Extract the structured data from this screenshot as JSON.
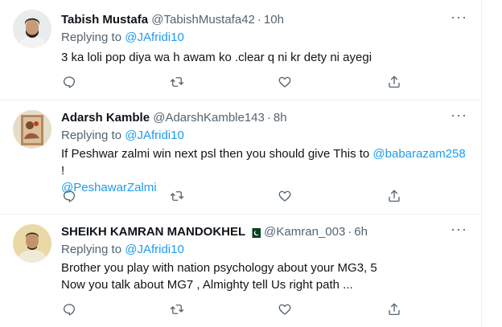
{
  "tweets": [
    {
      "name": "Tabish Mustafa",
      "handle": "@TabishMustafa42",
      "time": "10h",
      "replying_prefix": "Replying to ",
      "replying_to": "@JAfridi10",
      "text": "3 ka loli pop diya wa h awam ko .clear q ni kr dety ni ayegi"
    },
    {
      "name": "Adarsh Kamble",
      "handle": "@AdarshKamble143",
      "time": "8h",
      "replying_prefix": "Replying to ",
      "replying_to": "@JAfridi10",
      "text_pre": "If Peshwar zalmi win next psl then you should give This to ",
      "mention1": "@babarazam258",
      "text_post": " !",
      "mention2": "@PeshawarZalmi"
    },
    {
      "name": "SHEIKH KAMRAN MANDOKHEL",
      "handle": "@Kamran_003",
      "time": "6h",
      "replying_prefix": "Replying to ",
      "replying_to": "@JAfridi10",
      "line1": "Brother you play with nation psychology about your MG3, 5",
      "line2": "Now you talk about MG7 , Almighty tell Us right path ..."
    }
  ],
  "icons": {
    "reply": "reply-icon",
    "retweet": "retweet-icon",
    "like": "like-icon",
    "share": "share-icon",
    "more": "more-icon",
    "flag": "pakistan-flag-icon"
  },
  "colors": {
    "link": "#1d9bf0",
    "secondary": "#536471",
    "text": "#0f1419",
    "divider": "#eff3f4"
  }
}
